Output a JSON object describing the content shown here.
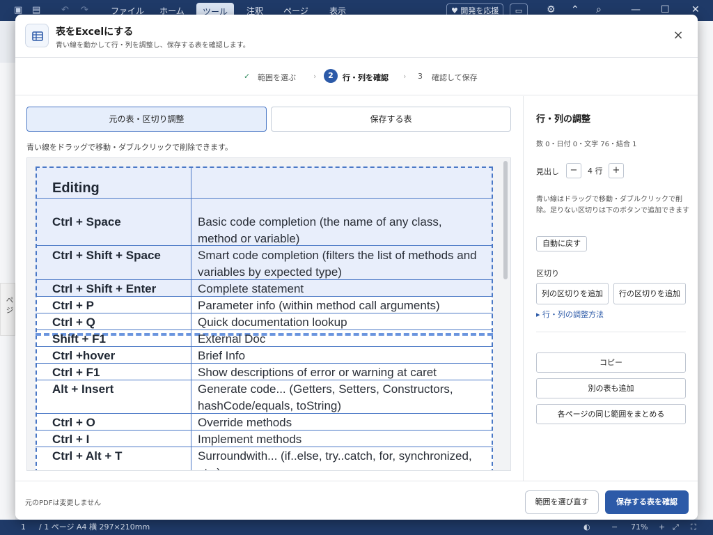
{
  "app": {
    "menu": [
      "ファイル",
      "ホーム",
      "ツール",
      "注釈",
      "ページ",
      "表示"
    ],
    "support_label": "開発を応援",
    "sidebar_tab": "ペ ジ",
    "status": {
      "page": "1",
      "page_total": "/ 1 ページ",
      "paper": "A4 横 297×210mm",
      "zoom": "71%"
    }
  },
  "dialog": {
    "title": "表をExcelにする",
    "subtitle": "青い線を動かして行・列を調整し、保存する表を確認します。",
    "steps": [
      {
        "num": "✓",
        "label": "範囲を選ぶ"
      },
      {
        "num": "2",
        "label": "行・列を確認"
      },
      {
        "num": "3",
        "label": "確認して保存"
      }
    ],
    "tabs": {
      "source": "元の表・区切り調整",
      "result": "保存する表"
    },
    "hint": "青い線をドラッグで移動・ダブルクリックで削除できます。",
    "table": {
      "header": "Editing",
      "rows": [
        {
          "key": "Ctrl + Space",
          "desc": "Basic code completion (the name of any class, method or variable)"
        },
        {
          "key": "Ctrl + Shift + Space",
          "desc": "Smart code completion (filters the list of methods and variables by expected type)"
        },
        {
          "key": "Ctrl + Shift + Enter",
          "desc": "Complete statement"
        },
        {
          "key": "Ctrl + P",
          "desc": "Parameter info (within method call arguments)"
        },
        {
          "key": "Ctrl + Q",
          "desc": "Quick documentation lookup"
        },
        {
          "key": "Shift + F1",
          "desc": "External Doc"
        },
        {
          "key": "Ctrl +hover",
          "desc": "Brief Info"
        },
        {
          "key": "Ctrl + F1",
          "desc": "Show descriptions of error or warning at caret"
        },
        {
          "key": "Alt + Insert",
          "desc": "Generate code... (Getters, Setters, Constructors, hashCode/equals, toString)"
        },
        {
          "key": "Ctrl + O",
          "desc": "Override methods"
        },
        {
          "key": "Ctrl + I",
          "desc": "Implement methods"
        },
        {
          "key": "Ctrl + Alt + T",
          "desc": "Surroundwith... (if..else, try..catch, for, synchronized, etc.)"
        }
      ]
    },
    "panel": {
      "title": "行・列の調整",
      "stats": "数 0・日付 0・文字 76・結合 1",
      "header_label": "見出し",
      "header_value": "4 行",
      "minus": "−",
      "plus": "+",
      "note": "青い線はドラッグで移動・ダブルクリックで削除。足りない区切りは下のボタンで追加できます",
      "reset": "自動に戻す",
      "divider_label": "区切り",
      "add_col": "列の区切りを追加",
      "add_row": "行の区切りを追加",
      "howto": "▸ 行・列の調整方法",
      "copy": "コピー",
      "add_table": "別の表も追加",
      "merge_pages": "各ページの同じ範囲をまとめる"
    },
    "footer": {
      "note": "元のPDFは変更しません",
      "reselect": "範囲を選び直す",
      "confirm": "保存する表を確認"
    }
  }
}
